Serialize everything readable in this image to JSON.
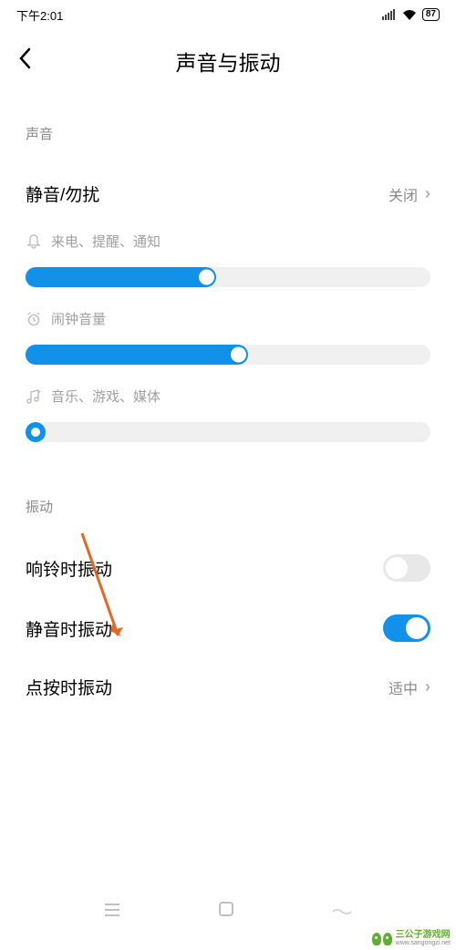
{
  "status": {
    "time": "下午2:01",
    "battery": "87"
  },
  "header": {
    "title": "声音与振动"
  },
  "sections": {
    "sound": {
      "label": "声音",
      "silent": {
        "label": "静音/勿扰",
        "value": "关闭"
      },
      "sliders": {
        "ring": {
          "label": "来电、提醒、通知",
          "percent": 47
        },
        "alarm": {
          "label": "闹钟音量",
          "percent": 55
        },
        "media": {
          "label": "音乐、游戏、媒体",
          "percent": 0
        }
      }
    },
    "vibration": {
      "label": "振动",
      "ring_vibrate": {
        "label": "响铃时振动",
        "on": false
      },
      "silent_vibrate": {
        "label": "静音时振动",
        "on": true
      },
      "touch_vibrate": {
        "label": "点按时振动",
        "value": "适中"
      }
    }
  },
  "watermark": {
    "name": "三公子游戏网",
    "url": "www.sangongzi.net"
  }
}
